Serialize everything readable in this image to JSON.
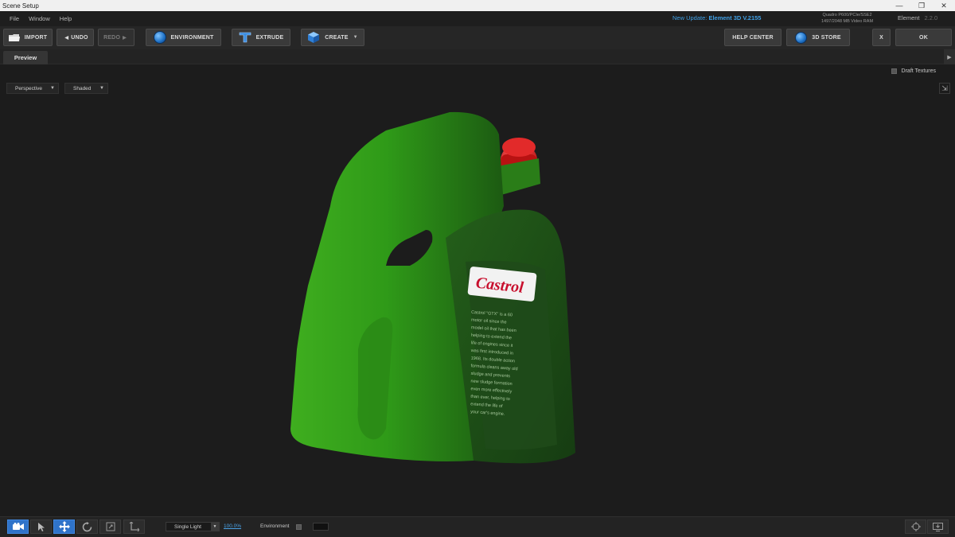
{
  "window": {
    "title": "Scene Setup",
    "controls": [
      "minimize-icon",
      "restore-icon",
      "close-icon"
    ]
  },
  "menu": {
    "items": [
      "File",
      "Window",
      "Help"
    ],
    "update_prefix": "New Update:",
    "update_version": "Element 3D V.2155",
    "gpu_line1": "Quadro P600/PCIe/SSE2",
    "gpu_line2": "1497/2048 MB Video RAM",
    "plugin_name": "Element",
    "plugin_version": "2.2.0"
  },
  "toolbar": {
    "import": "IMPORT",
    "undo": "UNDO",
    "redo": "REDO",
    "environment": "ENVIRONMENT",
    "extrude": "EXTRUDE",
    "create": "CREATE",
    "help_center": "HELP CENTER",
    "store": "3D STORE",
    "cancel": "X",
    "ok": "OK"
  },
  "tabs": {
    "preview": "Preview"
  },
  "viewport": {
    "draft_textures": "Draft Textures",
    "camera_mode": "Perspective",
    "shading_mode": "Shaded",
    "label_brand": "Castrol",
    "label_text": [
      "Castrol \"GTX\" is a 60",
      "motor oil since the",
      "model oil that has been",
      "helping to extend the",
      "life of engines since it",
      "was first introduced in",
      "1968. Its double action",
      "formula cleans away old",
      "sludge and prevents",
      "new sludge formation",
      "even more effectively",
      "than ever, helping to",
      "extend the life of",
      "your car's engine."
    ]
  },
  "bottom": {
    "tools": [
      "camera-icon",
      "select-arrow-icon",
      "move-icon",
      "rotate-icon",
      "scale-icon",
      "axis-icon"
    ],
    "light_mode": "Single Light",
    "zoom": "100.0%",
    "environment_label": "Environment",
    "right_icons": [
      "target-icon",
      "screen-icon"
    ]
  },
  "colors": {
    "accent": "#2f73c9",
    "link": "#4aa3e8",
    "bottle_green": "#2f8f1e",
    "cap_red": "#d01818"
  }
}
